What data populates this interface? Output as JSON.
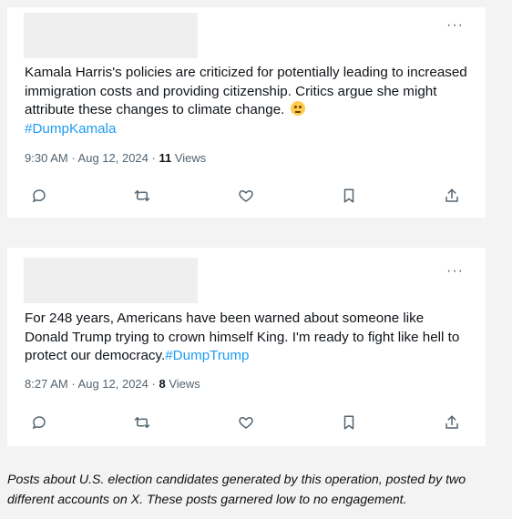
{
  "posts": [
    {
      "text": "Kamala Harris's policies are criticized for potentially leading to increased immigration costs and providing citizenship. Critics argue she might attribute these changes to climate change.",
      "emoji": "face-with-rolling-eyes",
      "hashtag": "#DumpKamala",
      "time": "9:30 AM",
      "date": "Aug 12, 2024",
      "views_count": "11",
      "views_label": "Views",
      "more_label": "···"
    },
    {
      "text": "For 248 years, Americans have been warned about someone like Donald Trump trying to crown himself King. I'm ready to fight like hell to protect our democracy.",
      "hashtag": "#DumpTrump",
      "time": "8:27 AM",
      "date": "Aug 12, 2024",
      "views_count": "8",
      "views_label": "Views",
      "more_label": "···"
    }
  ],
  "separator": " · ",
  "icons": [
    "reply-icon",
    "repost-icon",
    "like-icon",
    "bookmark-icon",
    "share-icon"
  ],
  "colors": {
    "hashtag": "#1d9bf0",
    "muted": "#536471",
    "text": "#0f1419"
  },
  "caption": "Posts about U.S. election candidates generated by this operation, posted by two different accounts on X. These posts garnered low to no engagement."
}
